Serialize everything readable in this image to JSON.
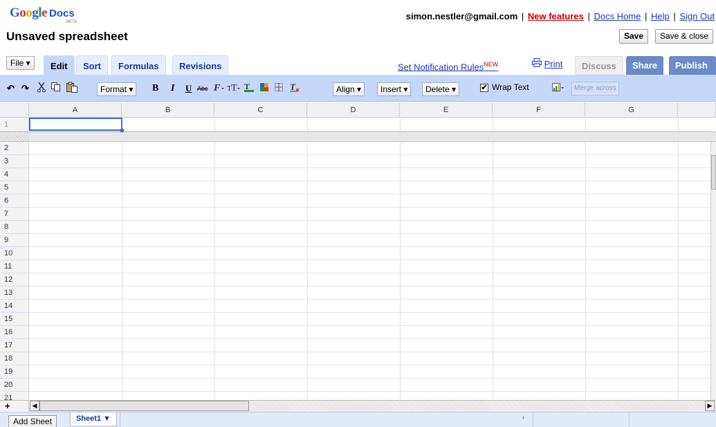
{
  "header": {
    "logo_google": "Google",
    "logo_docs": "Docs",
    "logo_beta": "BETA",
    "email": "simon.nestler@gmail.com",
    "new_features": "New features",
    "docs_home": "Docs Home",
    "help": "Help",
    "sign_out": "Sign Out",
    "doc_title": "Unsaved spreadsheet",
    "save": "Save",
    "save_close": "Save & close",
    "sep": "|"
  },
  "menu": {
    "file": "File ▾",
    "tabs": [
      "Edit",
      "Sort",
      "Formulas",
      "Revisions"
    ],
    "notification": "Set Notification Rules",
    "notification_badge": "NEW",
    "print": "Print",
    "discuss": "Discuss",
    "share": "Share",
    "publish": "Publish"
  },
  "toolbar": {
    "undo": "↶",
    "redo": "↷",
    "format": "Format ▾",
    "bold": "B",
    "italic": "I",
    "underline": "U",
    "strike": "Abc",
    "align": "Align ▾",
    "insert": "Insert ▾",
    "delete": "Delete ▾",
    "wrap_checked": "✔",
    "wrap_label": "Wrap Text",
    "merge": "Merge across"
  },
  "grid": {
    "columns": [
      "A",
      "B",
      "C",
      "D",
      "E",
      "F",
      "G"
    ],
    "rows": [
      "1",
      "2",
      "3",
      "4",
      "5",
      "6",
      "7",
      "8",
      "9",
      "10",
      "11",
      "12",
      "13",
      "14",
      "15",
      "16",
      "17",
      "18",
      "19",
      "20",
      "21"
    ],
    "selected_cell": "A1"
  },
  "footer": {
    "plus": "+",
    "add_sheet": "Add Sheet",
    "sheet1": "Sheet1 ▼",
    "scroll_left": "◀",
    "scroll_right": "▶",
    "mid_arrow": "›"
  }
}
